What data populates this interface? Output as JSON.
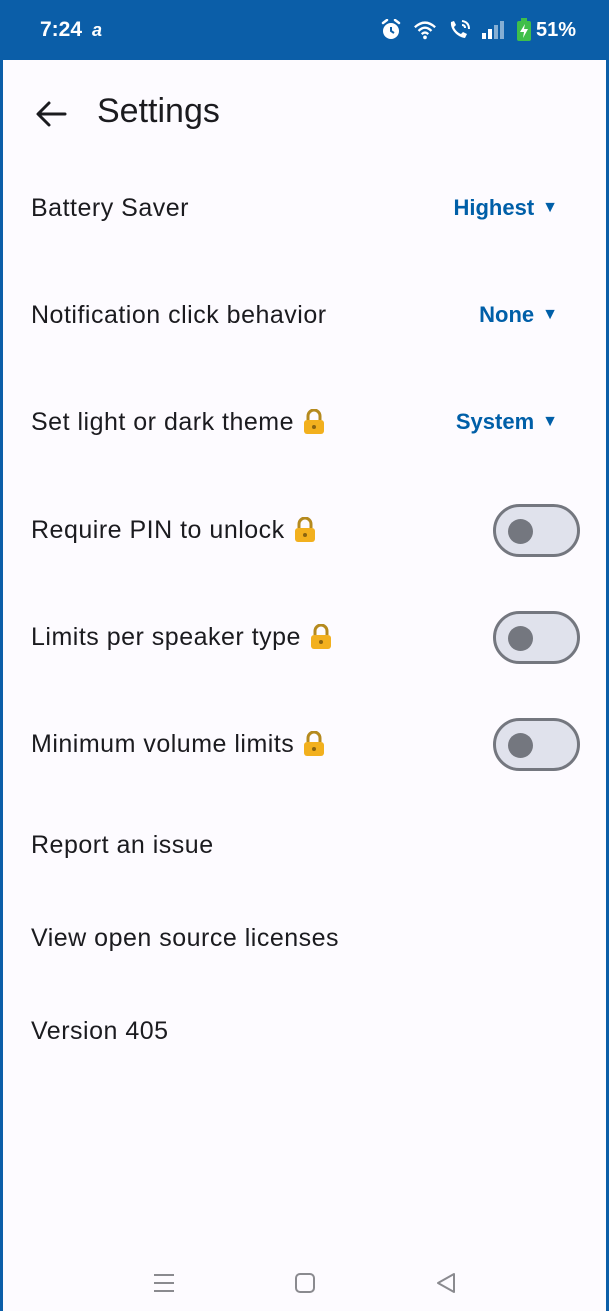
{
  "status_bar": {
    "time": "7:24",
    "misc": "a",
    "battery": "51%"
  },
  "header": {
    "title": "Settings"
  },
  "settings": {
    "battery_saver": {
      "label": "Battery Saver",
      "value": "Highest"
    },
    "notification_click": {
      "label": "Notification click behavior",
      "value": "None"
    },
    "theme": {
      "label": "Set light or dark theme",
      "value": "System"
    },
    "require_pin": {
      "label": "Require PIN to unlock",
      "enabled": false
    },
    "limits_speaker": {
      "label": "Limits per speaker type",
      "enabled": false
    },
    "min_volume": {
      "label": "Minimum volume limits",
      "enabled": false
    },
    "report_issue": {
      "label": "Report an issue"
    },
    "licenses": {
      "label": "View open source licenses"
    },
    "version": {
      "label": "Version 405"
    }
  },
  "dropdown_arrow": "▼",
  "colors": {
    "status_bar": "#0b5ea8",
    "accent": "#005fa8",
    "lock": "#f2b01e"
  },
  "icons": {
    "status": [
      "alarm-icon",
      "wifi-icon",
      "wifi-calling-icon",
      "signal-icon",
      "battery-charging-icon"
    ],
    "lock": "lock-icon",
    "nav": [
      "recents-icon",
      "home-icon",
      "back-nav-icon"
    ]
  }
}
